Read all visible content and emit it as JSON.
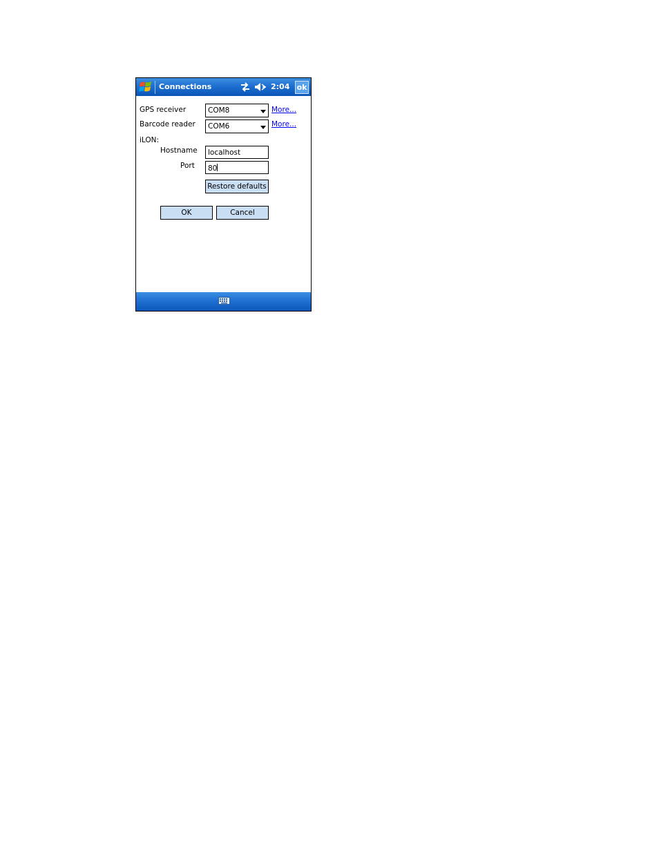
{
  "window": {
    "title": "Connections",
    "clock": "2:04",
    "ok_label": "ok"
  },
  "form": {
    "gps_label": "GPS receiver",
    "gps_value": "COM8",
    "barcode_label": "Barcode reader",
    "barcode_value": "COM6",
    "more_label": "More...",
    "ilon_label": "iLON:",
    "hostname_label": "Hostname",
    "hostname_value": "localhost",
    "port_label": "Port",
    "port_value": "80",
    "restore_label": "Restore defaults",
    "ok_label": "OK",
    "cancel_label": "Cancel"
  },
  "icons": {
    "start": "windows-flag-icon",
    "connectivity": "connectivity-icon",
    "volume": "volume-muted-icon",
    "keyboard": "keyboard-icon"
  },
  "colors": {
    "titlebar": "#1e6fd0",
    "button_face": "#c9ddf3",
    "link": "#0000ee"
  }
}
